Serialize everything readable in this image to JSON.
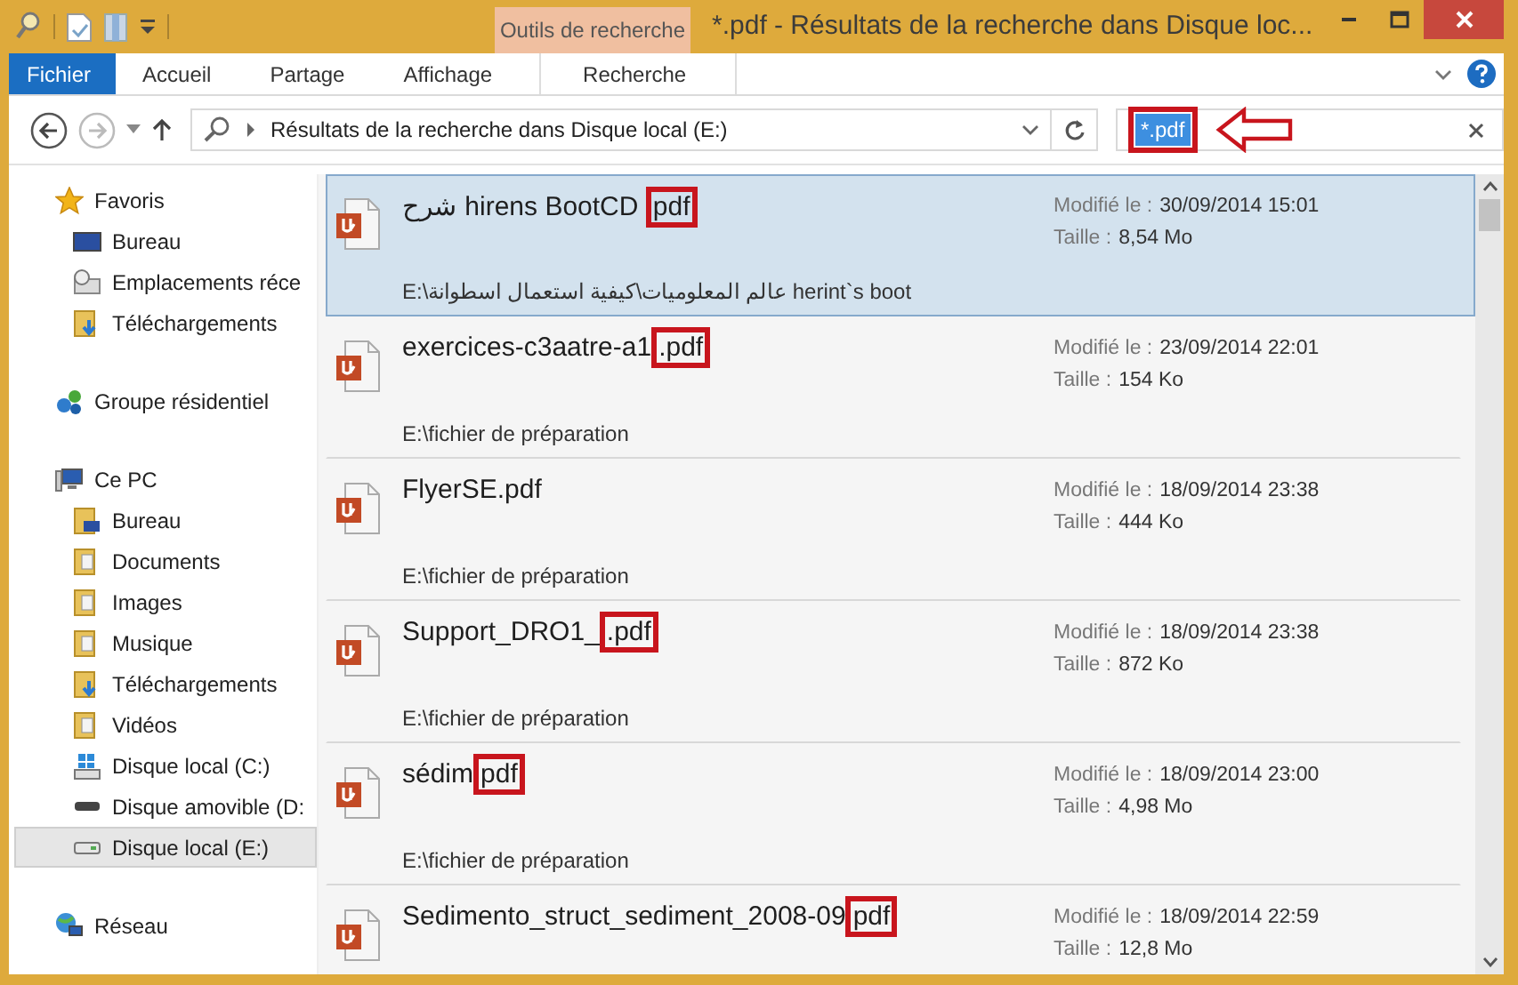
{
  "window": {
    "title": "*.pdf - Résultats de la recherche dans Disque loc...",
    "context_group": "Outils de recherche"
  },
  "ribbon_tabs": [
    {
      "label": "Fichier",
      "kind": "file",
      "selected": false
    },
    {
      "label": "Accueil",
      "kind": "tab",
      "selected": false
    },
    {
      "label": "Partage",
      "kind": "tab",
      "selected": false
    },
    {
      "label": "Affichage",
      "kind": "tab",
      "selected": false
    },
    {
      "label": "Recherche",
      "kind": "context",
      "selected": false
    }
  ],
  "address_bar": {
    "path": "Résultats de la recherche dans Disque local (E:)"
  },
  "search": {
    "value": "*.pdf",
    "text_selected": true,
    "annotated": true
  },
  "navigation": [
    {
      "label": "Favoris",
      "kind": "star",
      "selected": false,
      "children": [
        {
          "label": "Bureau",
          "kind": "desktop",
          "selected": false
        },
        {
          "label": "Emplacements réce",
          "kind": "recent",
          "selected": false
        },
        {
          "label": "Téléchargements",
          "kind": "downloads",
          "selected": false
        }
      ]
    },
    {
      "label": "Groupe résidentiel",
      "kind": "homegroup",
      "selected": false
    },
    {
      "label": "Ce PC",
      "kind": "pc",
      "selected": false,
      "children": [
        {
          "label": "Bureau",
          "kind": "desktopfolder",
          "selected": false
        },
        {
          "label": "Documents",
          "kind": "folder",
          "selected": false
        },
        {
          "label": "Images",
          "kind": "folder",
          "selected": false
        },
        {
          "label": "Musique",
          "kind": "folder",
          "selected": false
        },
        {
          "label": "Téléchargements",
          "kind": "downloads",
          "selected": false
        },
        {
          "label": "Vidéos",
          "kind": "folder",
          "selected": false
        },
        {
          "label": "Disque local (C:)",
          "kind": "systemdrive",
          "selected": false
        },
        {
          "label": "Disque amovible (D:",
          "kind": "removable",
          "selected": false
        },
        {
          "label": "Disque local (E:)",
          "kind": "drive",
          "selected": true
        }
      ]
    },
    {
      "label": "Réseau",
      "kind": "network",
      "selected": false
    }
  ],
  "results": [
    {
      "name": "شرح hirens BootCD ",
      "marked": "pdf",
      "modified_label": "Modifié le :",
      "modified": "30/09/2014 15:01",
      "size_label": "Taille :",
      "size": "8,54 Mo",
      "path": "E:\\عالم المعلوميات\\كيفية استعمال اسطوانة herint`s boot",
      "selected": true
    },
    {
      "name": "exercices-c3aatre-a1",
      "marked": ".pdf",
      "modified_label": "Modifié le :",
      "modified": "23/09/2014 22:01",
      "size_label": "Taille :",
      "size": "154 Ko",
      "path": "E:\\fichier de préparation",
      "selected": false
    },
    {
      "name": "FlyerSE.pdf",
      "modified_label": "Modifié le :",
      "modified": "18/09/2014 23:38",
      "size_label": "Taille :",
      "size": "444 Ko",
      "path": "E:\\fichier de préparation",
      "selected": false
    },
    {
      "name": "Support_DRO1_",
      "marked": ".pdf",
      "modified_label": "Modifié le :",
      "modified": "18/09/2014 23:38",
      "size_label": "Taille :",
      "size": "872 Ko",
      "path": "E:\\fichier de préparation",
      "selected": false
    },
    {
      "name": "sédim",
      "marked": "pdf",
      "modified_label": "Modifié le :",
      "modified": "18/09/2014 23:00",
      "size_label": "Taille :",
      "size": "4,98 Mo",
      "path": "E:\\fichier de préparation",
      "selected": false
    },
    {
      "name": "Sedimento_struct_sediment_2008-09",
      "marked": "pdf",
      "modified_label": "Modifié le :",
      "modified": "18/09/2014 22:59",
      "size_label": "Taille :",
      "size": "12,8 Mo",
      "selected": false
    }
  ]
}
